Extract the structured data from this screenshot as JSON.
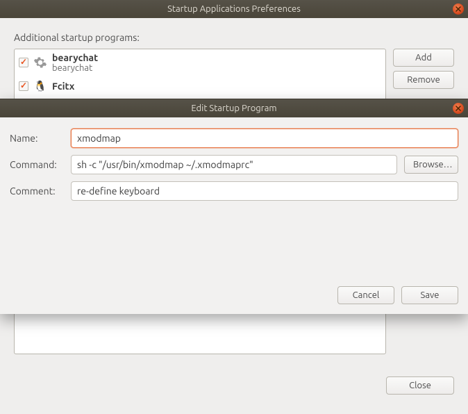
{
  "main_window": {
    "title": "Startup Applications Preferences",
    "section_label": "Additional startup programs:",
    "programs": [
      {
        "checked": true,
        "icon": "gear",
        "name": "bearychat",
        "desc": "bearychat"
      },
      {
        "checked": true,
        "icon": "penguin",
        "name": "Fcitx",
        "desc": ""
      }
    ],
    "buttons": {
      "add": "Add",
      "remove": "Remove",
      "close": "Close"
    }
  },
  "dialog": {
    "title": "Edit Startup Program",
    "labels": {
      "name": "Name:",
      "command": "Command:",
      "comment": "Comment:"
    },
    "fields": {
      "name": "xmodmap",
      "command": "sh -c \"/usr/bin/xmodmap ~/.xmodmaprc\"",
      "comment": "re-define keyboard"
    },
    "buttons": {
      "browse": "Browse…",
      "cancel": "Cancel",
      "save": "Save"
    }
  }
}
